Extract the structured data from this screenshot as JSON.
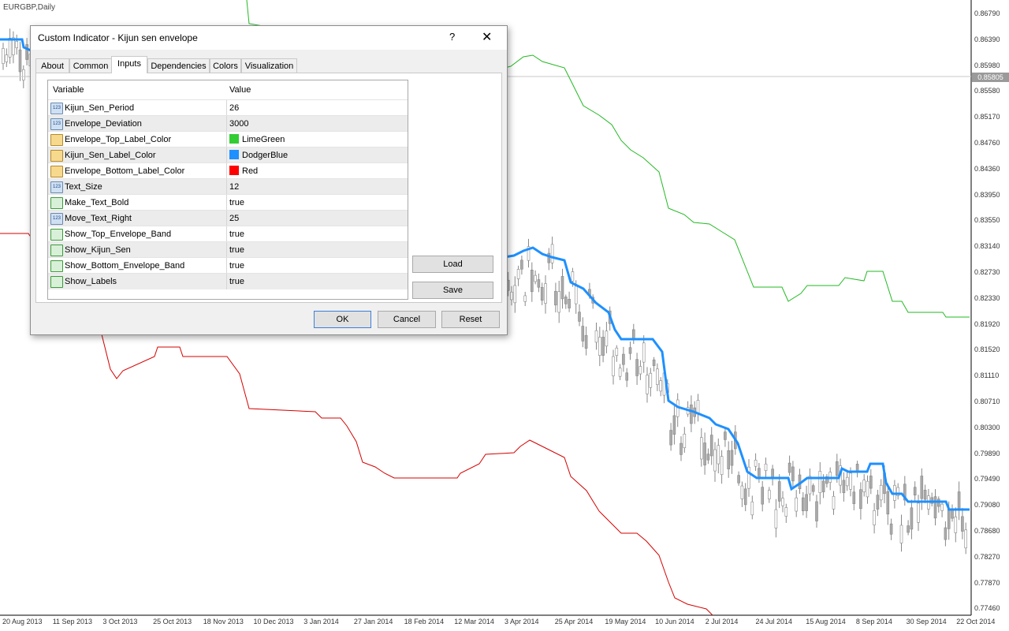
{
  "chart": {
    "symbol": "EURGBP,Daily",
    "current_price": "0.85805",
    "price_labels": [
      "0.86790",
      "0.86390",
      "0.85980",
      "0.85580",
      "0.85170",
      "0.84760",
      "0.84360",
      "0.83950",
      "0.83550",
      "0.83140",
      "0.82730",
      "0.82330",
      "0.81920",
      "0.81520",
      "0.81110",
      "0.80710",
      "0.80300",
      "0.79890",
      "0.79490",
      "0.79080",
      "0.78680",
      "0.78270",
      "0.77870",
      "0.77460"
    ],
    "date_labels": [
      "20 Aug 2013",
      "11 Sep 2013",
      "3 Oct 2013",
      "25 Oct 2013",
      "18 Nov 2013",
      "10 Dec 2013",
      "3 Jan 2014",
      "27 Jan 2014",
      "18 Feb 2014",
      "12 Mar 2014",
      "3 Apr 2014",
      "25 Apr 2014",
      "19 May 2014",
      "10 Jun 2014",
      "2 Jul 2014",
      "24 Jul 2014",
      "15 Aug 2014",
      "8 Sep 2014",
      "30 Sep 2014",
      "22 Oct 2014"
    ],
    "colors": {
      "top_band": "#22b922",
      "kijun": "#1e90ff",
      "bottom_band": "#d40000"
    }
  },
  "dialog": {
    "title": "Custom Indicator - Kijun sen envelope",
    "help_icon": "?",
    "close_icon": "✕",
    "tabs": [
      "About",
      "Common",
      "Inputs",
      "Dependencies",
      "Colors",
      "Visualization"
    ],
    "active_tab": "Inputs",
    "columns": {
      "variable": "Variable",
      "value": "Value"
    },
    "inputs": [
      {
        "name": "Kijun_Sen_Period",
        "value": "26",
        "type": "123"
      },
      {
        "name": "Envelope_Deviation",
        "value": "3000",
        "type": "123"
      },
      {
        "name": "Envelope_Top_Label_Color",
        "value": "LimeGreen",
        "type": "color",
        "swatch": "#32cd32"
      },
      {
        "name": "Kijun_Sen_Label_Color",
        "value": "DodgerBlue",
        "type": "color",
        "swatch": "#1e90ff"
      },
      {
        "name": "Envelope_Bottom_Label_Color",
        "value": "Red",
        "type": "color",
        "swatch": "#ff0000"
      },
      {
        "name": "Text_Size",
        "value": "12",
        "type": "123"
      },
      {
        "name": "Make_Text_Bold",
        "value": "true",
        "type": "bool"
      },
      {
        "name": "Move_Text_Right",
        "value": "25",
        "type": "123"
      },
      {
        "name": "Show_Top_Envelope_Band",
        "value": "true",
        "type": "bool"
      },
      {
        "name": "Show_Kijun_Sen",
        "value": "true",
        "type": "bool"
      },
      {
        "name": "Show_Bottom_Envelope_Band",
        "value": "true",
        "type": "bool"
      },
      {
        "name": "Show_Labels",
        "value": "true",
        "type": "bool"
      }
    ],
    "buttons": {
      "load": "Load",
      "save": "Save",
      "ok": "OK",
      "cancel": "Cancel",
      "reset": "Reset"
    }
  }
}
